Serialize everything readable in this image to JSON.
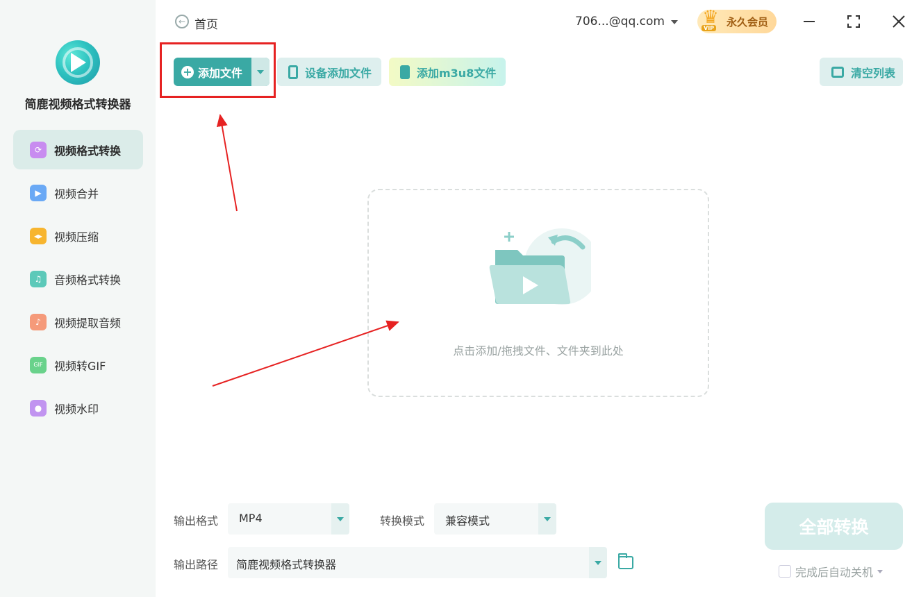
{
  "app": {
    "name": "简鹿视频格式转换器"
  },
  "sidebar": {
    "items": [
      {
        "label": "视频格式转换",
        "active": true,
        "icon": "video-convert-icon",
        "color": "#c88cf0"
      },
      {
        "label": "视频合并",
        "active": false,
        "icon": "video-merge-icon",
        "color": "#6aa9f5"
      },
      {
        "label": "视频压缩",
        "active": false,
        "icon": "video-compress-icon",
        "color": "#f7b52f"
      },
      {
        "label": "音频格式转换",
        "active": false,
        "icon": "audio-convert-icon",
        "color": "#5cc9b9"
      },
      {
        "label": "视频提取音频",
        "active": false,
        "icon": "extract-audio-icon",
        "color": "#f59a7a"
      },
      {
        "label": "视频转GIF",
        "active": false,
        "icon": "gif-icon",
        "color": "#69d28b"
      },
      {
        "label": "视频水印",
        "active": false,
        "icon": "watermark-icon",
        "color": "#c194f0"
      }
    ]
  },
  "header": {
    "home_label": "首页",
    "account": "706...@qq.com",
    "vip_label": "永久会员",
    "vip_tag": "VIP"
  },
  "toolbar": {
    "add_file": "添加文件",
    "device_add": "设备添加文件",
    "add_m3u8": "添加m3u8文件",
    "clear_list": "清空列表"
  },
  "dropzone": {
    "hint": "点击添加/拖拽文件、文件夹到此处"
  },
  "settings": {
    "output_format_label": "输出格式",
    "output_format_value": "MP4",
    "convert_mode_label": "转换模式",
    "convert_mode_value": "兼容模式",
    "output_path_label": "输出路径",
    "output_path_value": "简鹿视频格式转换器"
  },
  "actions": {
    "convert_all": "全部转换",
    "shutdown_after": "完成后自动关机"
  },
  "colors": {
    "accent": "#3aa9a4",
    "highlight": "#e62222"
  }
}
